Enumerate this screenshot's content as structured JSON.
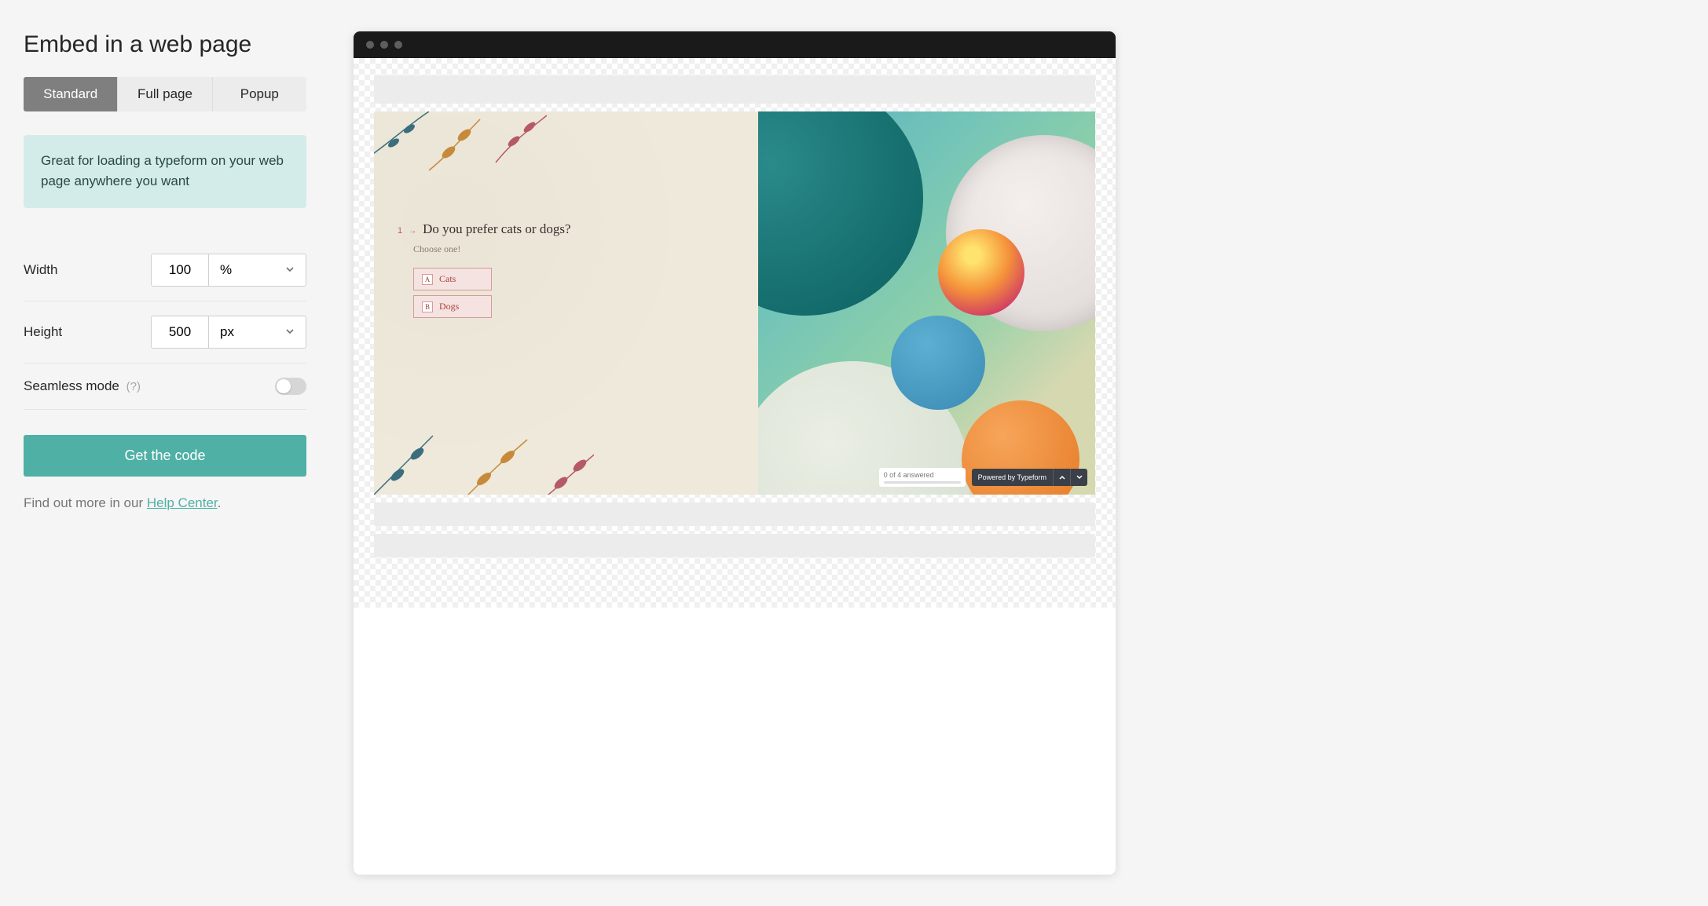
{
  "title": "Embed in a web page",
  "tabs": {
    "standard": "Standard",
    "fullpage": "Full page",
    "popup": "Popup"
  },
  "info": "Great for loading a typeform on your web page anywhere you want",
  "width": {
    "label": "Width",
    "value": "100",
    "unit": "%"
  },
  "height": {
    "label": "Height",
    "value": "500",
    "unit": "px"
  },
  "seamless": {
    "label": "Seamless mode",
    "hint": "(?)"
  },
  "cta": "Get the code",
  "help": {
    "prefix": "Find out more in our ",
    "link": "Help Center",
    "suffix": "."
  },
  "preview": {
    "question_number": "1",
    "question": "Do you prefer cats or dogs?",
    "hint": "Choose one!",
    "options": [
      {
        "key": "A",
        "label": "Cats"
      },
      {
        "key": "B",
        "label": "Dogs"
      }
    ],
    "progress": "0 of 4 answered",
    "powered": "Powered by Typeform"
  }
}
